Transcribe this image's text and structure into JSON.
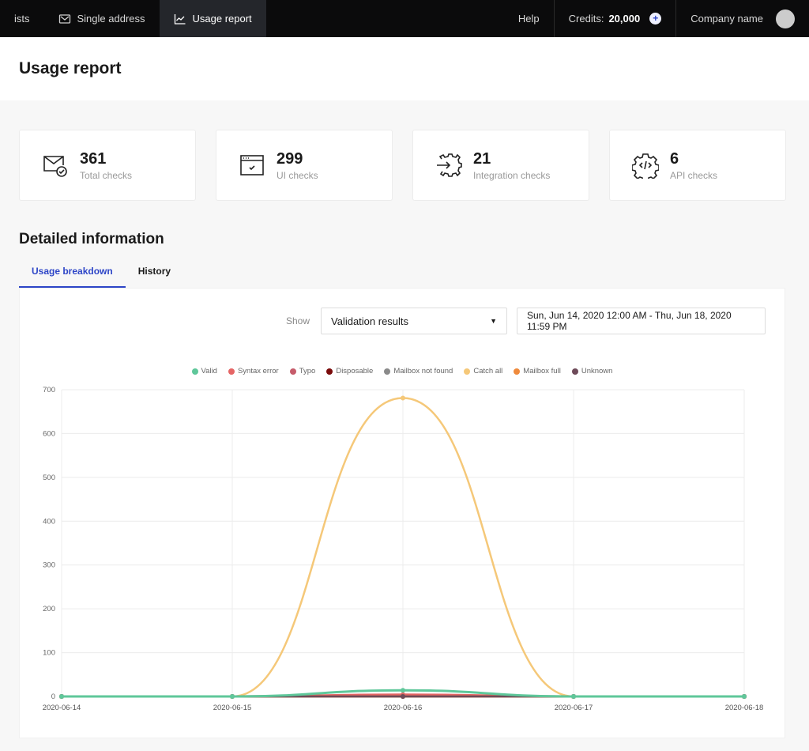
{
  "nav": {
    "items": [
      {
        "label": "ists",
        "icon": "list-icon",
        "active": false
      },
      {
        "label": "Single address",
        "icon": "envelope-icon",
        "active": false
      },
      {
        "label": "Usage report",
        "icon": "chart-line-icon",
        "active": true
      }
    ],
    "help": "Help",
    "credits_label": "Credits:",
    "credits_value": "20,000",
    "add_credits_icon": "plus-icon",
    "company": "Company name"
  },
  "header": {
    "title": "Usage report"
  },
  "stats": [
    {
      "value": "361",
      "label": "Total checks",
      "icon": "envelope-check-icon"
    },
    {
      "value": "299",
      "label": "UI checks",
      "icon": "browser-window-check-icon"
    },
    {
      "value": "21",
      "label": "Integration checks",
      "icon": "gear-arrow-icon"
    },
    {
      "value": "6",
      "label": "API checks",
      "icon": "gear-code-icon"
    }
  ],
  "detail": {
    "title": "Detailed information",
    "tabs": [
      {
        "label": "Usage breakdown",
        "active": true
      },
      {
        "label": "History",
        "active": false
      }
    ],
    "show_label": "Show",
    "select_value": "Validation results",
    "date_range": "Sun, Jun 14, 2020 12:00 AM - Thu, Jun 18, 2020 11:59 PM"
  },
  "chart_data": {
    "type": "line",
    "x": [
      "2020-06-14",
      "2020-06-15",
      "2020-06-16",
      "2020-06-17",
      "2020-06-18"
    ],
    "ylim": [
      0,
      700
    ],
    "yticks": [
      0,
      100,
      200,
      300,
      400,
      500,
      600,
      700
    ],
    "grid": true,
    "legend": "top-center",
    "series": [
      {
        "name": "Valid",
        "color": "#5fc79a",
        "values": [
          0,
          0,
          14,
          0,
          0
        ]
      },
      {
        "name": "Syntax error",
        "color": "#e56565",
        "values": [
          0,
          0,
          4,
          0,
          0
        ]
      },
      {
        "name": "Typo",
        "color": "#c65c6b",
        "values": [
          0,
          0,
          0,
          0,
          0
        ]
      },
      {
        "name": "Disposable",
        "color": "#7a0b0b",
        "values": [
          0,
          0,
          0,
          0,
          0
        ]
      },
      {
        "name": "Mailbox not found",
        "color": "#8a8a8a",
        "values": [
          0,
          0,
          0,
          0,
          0
        ]
      },
      {
        "name": "Catch all",
        "color": "#f5c879",
        "values": [
          0,
          0,
          681,
          0,
          0
        ]
      },
      {
        "name": "Mailbox full",
        "color": "#ef8a3c",
        "values": [
          0,
          0,
          0,
          0,
          0
        ]
      },
      {
        "name": "Unknown",
        "color": "#6e4a59",
        "values": [
          0,
          0,
          0,
          0,
          0
        ]
      }
    ]
  }
}
